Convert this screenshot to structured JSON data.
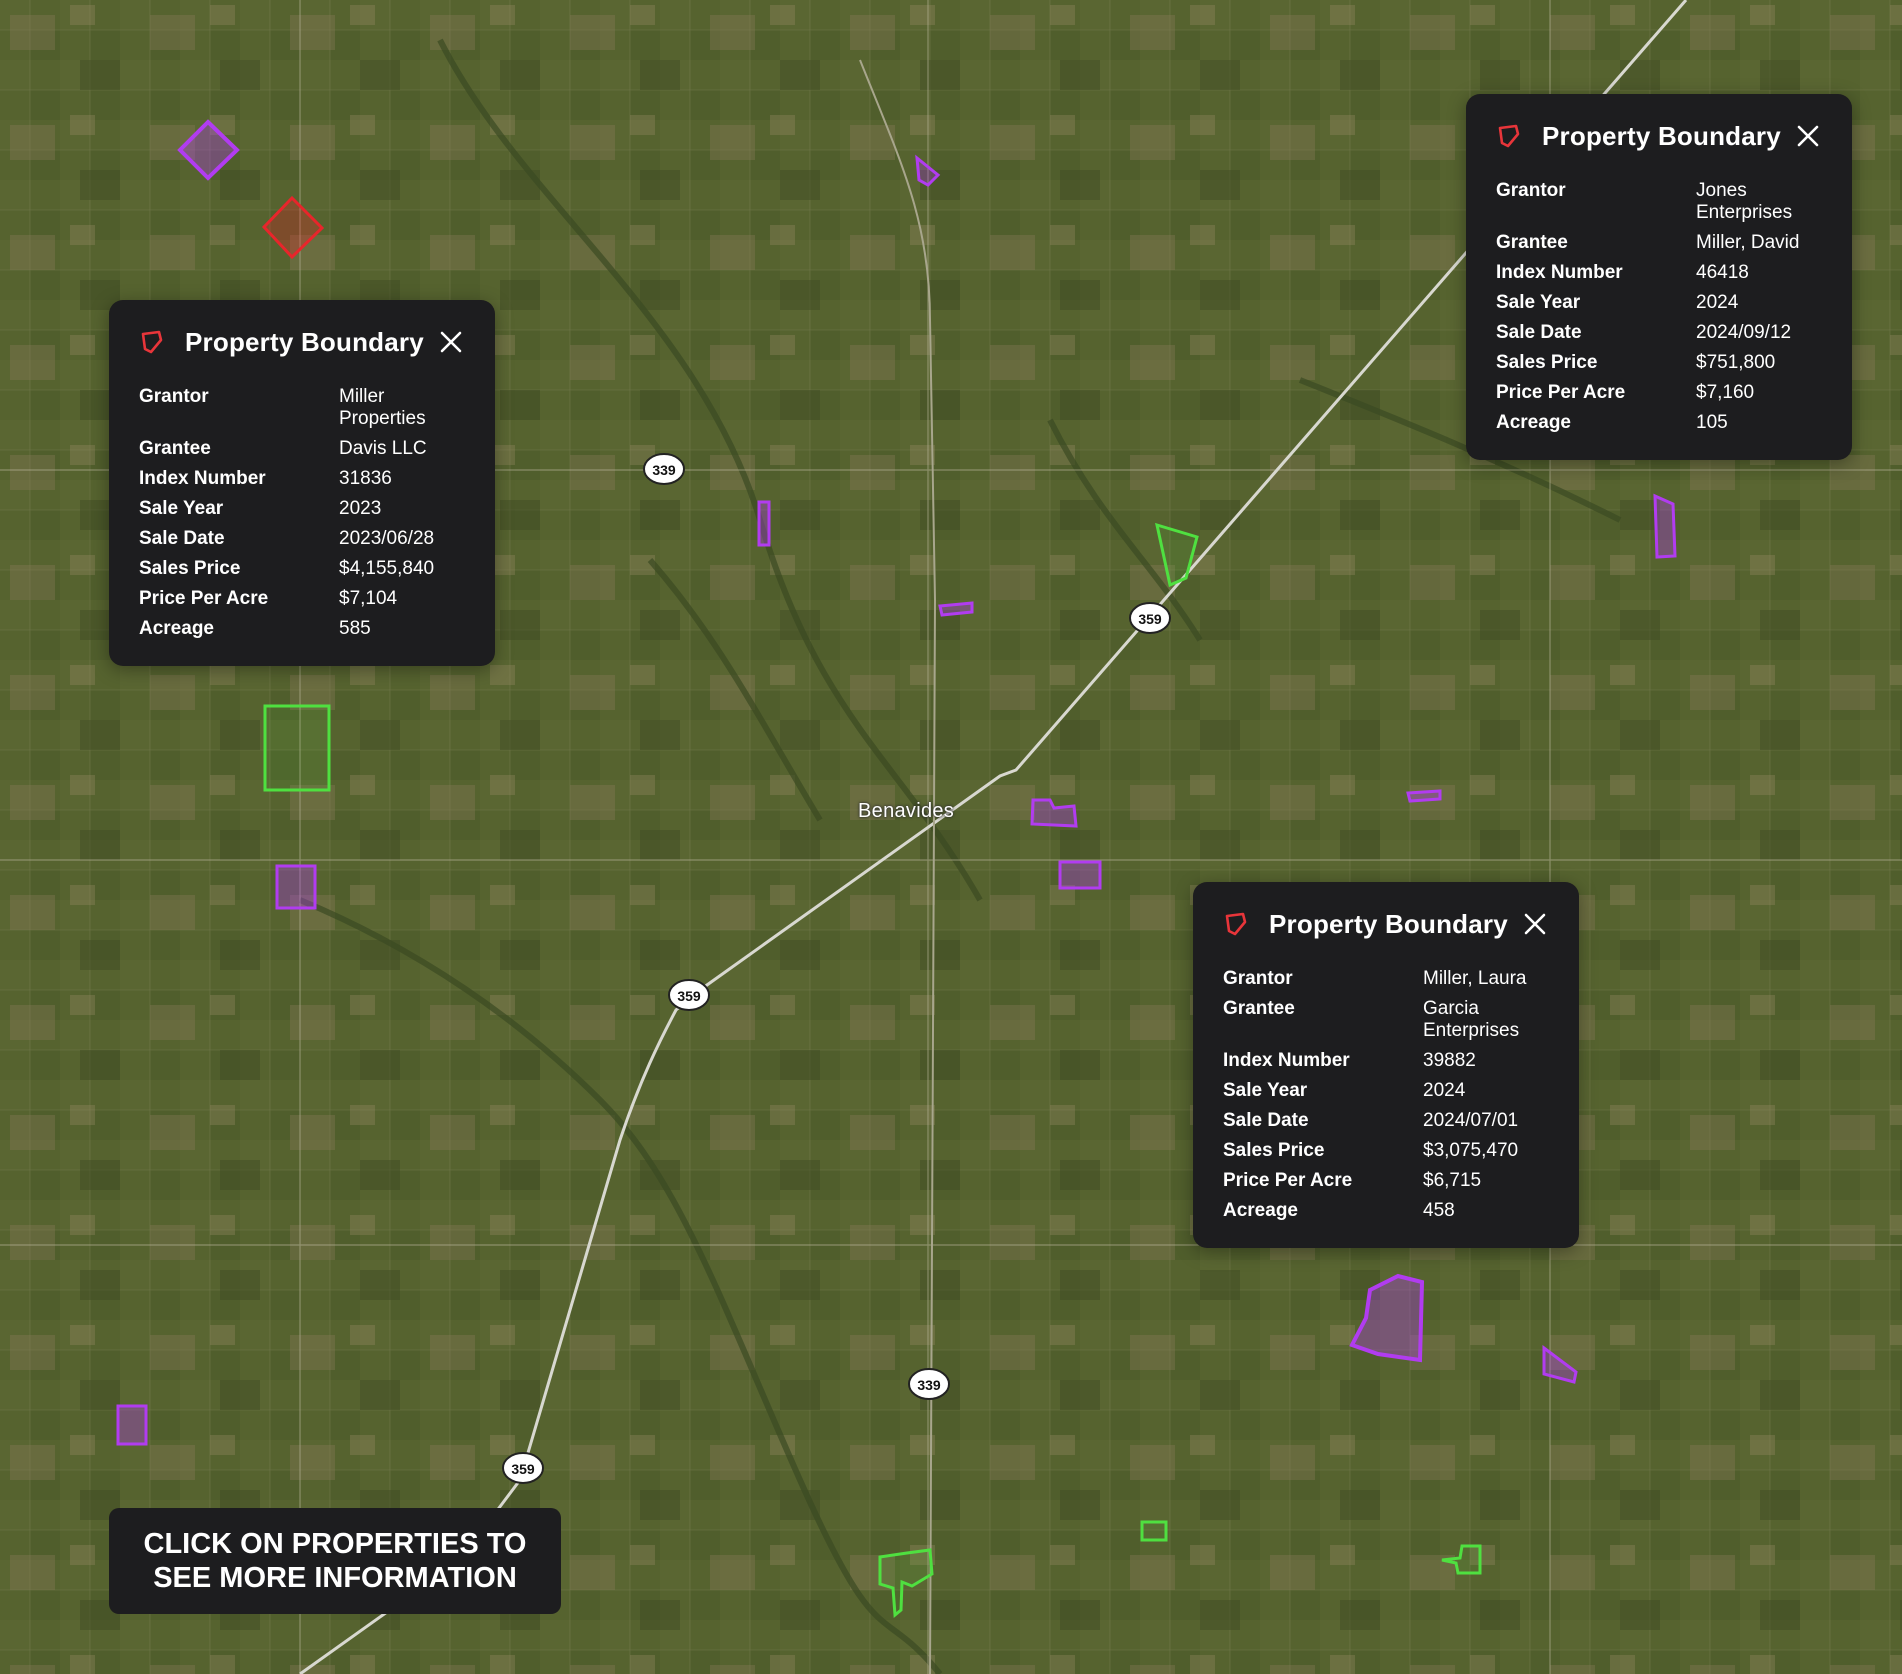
{
  "map": {
    "town_label": "Benavides",
    "route_shields": [
      "339",
      "359",
      "359",
      "339",
      "359"
    ]
  },
  "popups": [
    {
      "title": "Property Boundary",
      "rows": [
        {
          "label": "Grantor",
          "value": "Miller Properties"
        },
        {
          "label": "Grantee",
          "value": "Davis LLC"
        },
        {
          "label": "Index Number",
          "value": "31836"
        },
        {
          "label": "Sale Year",
          "value": "2023"
        },
        {
          "label": "Sale Date",
          "value": "2023/06/28"
        },
        {
          "label": "Sales Price",
          "value": "$4,155,840"
        },
        {
          "label": "Price Per Acre",
          "value": "$7,104"
        },
        {
          "label": "Acreage",
          "value": "585"
        }
      ]
    },
    {
      "title": "Property Boundary",
      "rows": [
        {
          "label": "Grantor",
          "value": "Jones Enterprises"
        },
        {
          "label": "Grantee",
          "value": "Miller, David"
        },
        {
          "label": "Index Number",
          "value": "46418"
        },
        {
          "label": "Sale Year",
          "value": "2024"
        },
        {
          "label": "Sale Date",
          "value": "2024/09/12"
        },
        {
          "label": "Sales Price",
          "value": "$751,800"
        },
        {
          "label": "Price Per Acre",
          "value": "$7,160"
        },
        {
          "label": "Acreage",
          "value": "105"
        }
      ]
    },
    {
      "title": "Property Boundary",
      "rows": [
        {
          "label": "Grantor",
          "value": "Miller, Laura"
        },
        {
          "label": "Grantee",
          "value": "Garcia Enterprises"
        },
        {
          "label": "Index Number",
          "value": "39882"
        },
        {
          "label": "Sale Year",
          "value": "2024"
        },
        {
          "label": "Sale Date",
          "value": "2024/07/01"
        },
        {
          "label": "Sales Price",
          "value": "$3,075,470"
        },
        {
          "label": "Price Per Acre",
          "value": "$6,715"
        },
        {
          "label": "Acreage",
          "value": "458"
        }
      ]
    }
  ],
  "hint": {
    "text": "CLICK ON PROPERTIES TO SEE MORE INFORMATION"
  },
  "colors": {
    "parcel_purple": "#b13cf0",
    "parcel_red": "#e8252b",
    "parcel_green": "#4fe040",
    "popup_bg": "#1d1d1f",
    "pin_icon": "#e8353a"
  }
}
